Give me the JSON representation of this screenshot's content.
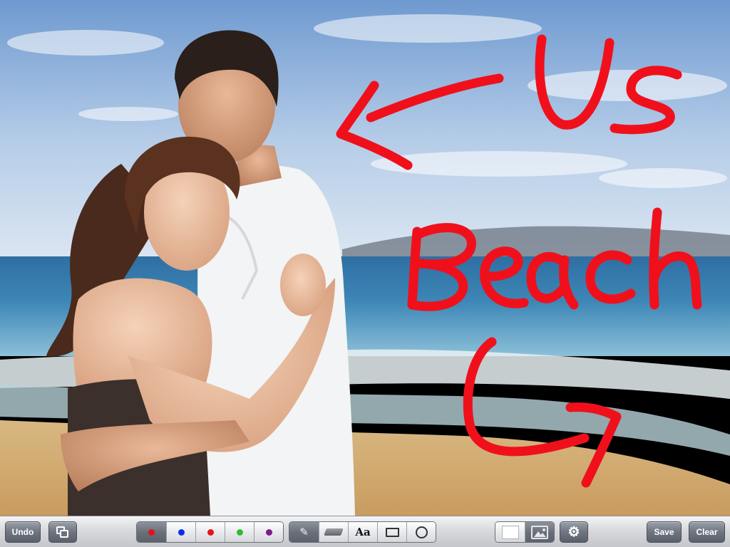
{
  "canvas": {
    "annotation_color": "#f0101c",
    "annotations": [
      {
        "name": "handwritten-us"
      },
      {
        "name": "handwritten-beach"
      }
    ]
  },
  "toolbar": {
    "undo_label": "Undo",
    "duplicate_icon": "layers-icon",
    "colors": [
      {
        "name": "red",
        "hex": "#e8101c",
        "selected": true
      },
      {
        "name": "blue",
        "hex": "#0b2cf0",
        "selected": false
      },
      {
        "name": "red",
        "hex": "#e8101c",
        "selected": false
      },
      {
        "name": "green",
        "hex": "#2fbd2f",
        "selected": false
      },
      {
        "name": "purple",
        "hex": "#7d1a8c",
        "selected": false
      }
    ],
    "tools": {
      "pen_icon": "pencil-icon",
      "eraser_icon": "eraser-icon",
      "text_label": "Aa",
      "rect_icon": "rectangle-icon",
      "circle_icon": "circle-icon",
      "active_tool": "pencil"
    },
    "background": {
      "blank_icon": "blank-page-icon",
      "photo_icon": "photo-icon",
      "active": "photo"
    },
    "settings_icon": "gear-icon",
    "save_label": "Save",
    "clear_label": "Clear"
  }
}
